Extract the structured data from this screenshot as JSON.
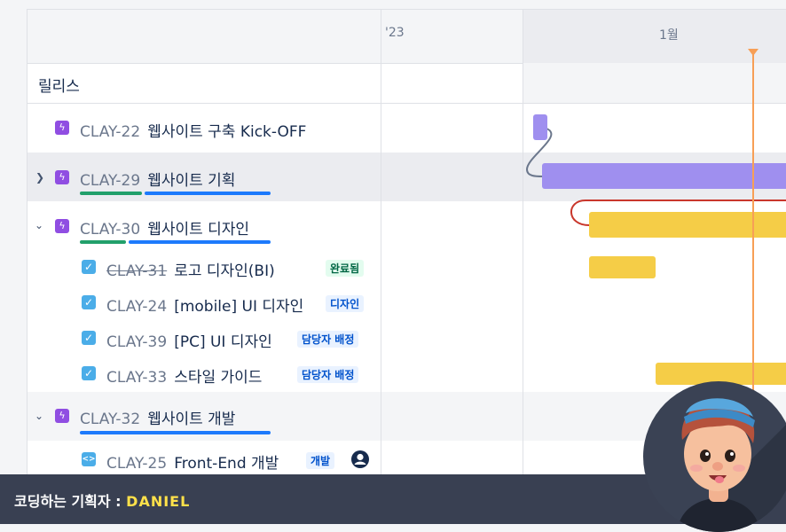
{
  "timeline": {
    "months": [
      "'23",
      "1월"
    ]
  },
  "release": {
    "label": "릴리스"
  },
  "issues": [
    {
      "key": "CLAY-22",
      "summary": "웹사이트 구축 Kick-OFF",
      "type": "epic"
    },
    {
      "key": "CLAY-29",
      "summary": "웹사이트 기획",
      "type": "epic",
      "expanded": false,
      "progress_done": 0.33,
      "progress_in_progress": 0.67
    },
    {
      "key": "CLAY-30",
      "summary": "웹사이트 디자인",
      "type": "epic",
      "expanded": true,
      "progress_done": 0.25,
      "progress_in_progress": 0.75
    },
    {
      "key": "CLAY-31",
      "summary": "로고 디자인(BI)",
      "type": "task",
      "status": "완료됨",
      "done": true
    },
    {
      "key": "CLAY-24",
      "summary": "[mobile] UI 디자인",
      "type": "task",
      "status": "디자인"
    },
    {
      "key": "CLAY-39",
      "summary": "[PC] UI 디자인",
      "type": "task",
      "status": "담당자 배정"
    },
    {
      "key": "CLAY-33",
      "summary": "스타일 가이드",
      "type": "task",
      "status": "담당자 배정"
    },
    {
      "key": "CLAY-32",
      "summary": "웹사이트 개발",
      "type": "epic",
      "expanded": true,
      "progress_done": 0,
      "progress_in_progress": 1
    },
    {
      "key": "CLAY-25",
      "summary": "Front-End 개발",
      "type": "code",
      "status": "개발"
    }
  ],
  "footer": {
    "label": "코딩하는 기획자 : ",
    "name": "DANIEL"
  },
  "colors": {
    "epic": "#904ee2",
    "task": "#4bade8",
    "bar_epic": "#9f8fef",
    "bar_task": "#f5cd47",
    "today_marker": "#f79f56",
    "footer_bg": "#394052",
    "footer_name": "#ffe14a"
  },
  "icons": [
    "epic-lightning-icon",
    "task-checkbox-icon",
    "code-icon",
    "chevron-right-icon",
    "chevron-down-icon",
    "user-avatar-icon"
  ]
}
